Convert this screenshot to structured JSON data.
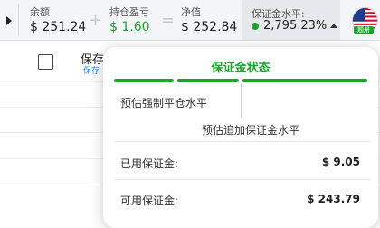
{
  "topbar": {
    "balance": {
      "label": "余额",
      "value": "$ 251.24"
    },
    "plus_sign": "+",
    "pnl": {
      "label": "持仓盈亏",
      "value": "$ 1.60"
    },
    "equals_sign": "=",
    "equity": {
      "label": "净值",
      "value": "$ 252.84"
    },
    "margin_level": {
      "label": "保证金水平:",
      "value": "2,795.23%"
    },
    "flag_badge": "题册"
  },
  "list": {
    "column_title": "保存",
    "column_sub": "保存"
  },
  "popover": {
    "title": "保证金状态",
    "forced_close_label": "预估强制平仓水平",
    "add_margin_label": "预估追加保证金水平",
    "used_margin_label": "已用保证金:",
    "used_margin_value": "$ 9.05",
    "free_margin_label": "可用保证金:",
    "free_margin_value": "$ 243.79"
  },
  "colors": {
    "accent_green": "#1da32f",
    "link_blue": "#2f7de1"
  }
}
